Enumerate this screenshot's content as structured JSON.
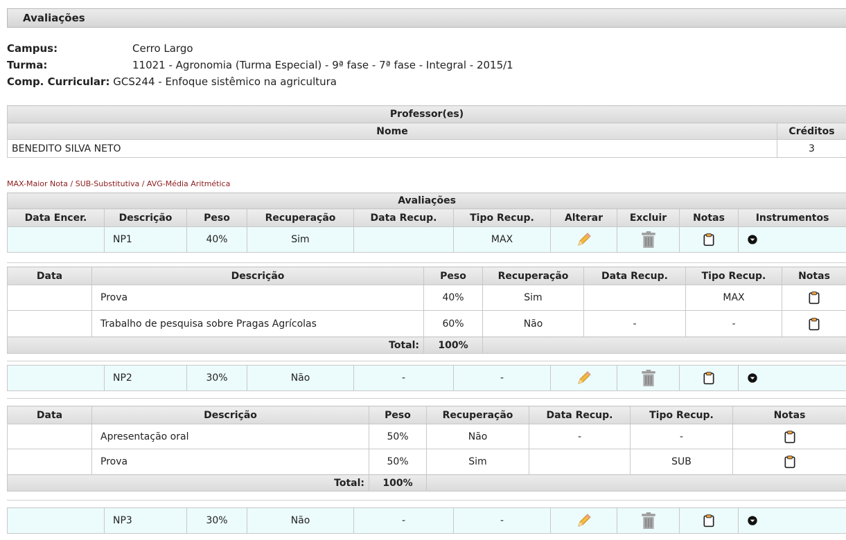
{
  "page_title": "Avaliações",
  "info": {
    "campus_label": "Campus:",
    "campus": "Cerro Largo",
    "turma_label": "Turma:",
    "turma": "11021 - Agronomia (Turma Especial) - 9ª fase - 7ª fase - Integral - 2015/1",
    "comp_label": "Comp. Curricular:",
    "comp": "GCS244 - Enfoque sistêmico na agricultura"
  },
  "professores": {
    "title": "Professor(es)",
    "col_nome": "Nome",
    "col_creditos": "Créditos",
    "rows": [
      {
        "nome": "BENEDITO SILVA NETO",
        "creditos": "3"
      }
    ]
  },
  "legend": "MAX-Maior Nota / SUB-Substitutiva / AVG-Média Aritmética",
  "avaliacoes": {
    "title": "Avaliações",
    "headers": [
      "Data Encer.",
      "Descrição",
      "Peso",
      "Recuperação",
      "Data Recup.",
      "Tipo Recup.",
      "Alterar",
      "Excluir",
      "Notas",
      "Instrumentos"
    ],
    "rows": [
      {
        "data": "",
        "descricao": "NP1",
        "peso": "40%",
        "recuperacao": "Sim",
        "data_recup": "",
        "tipo_recup": "MAX"
      },
      {
        "data": "",
        "descricao": "NP2",
        "peso": "30%",
        "recuperacao": "Não",
        "data_recup": "-",
        "tipo_recup": "-"
      },
      {
        "data": "",
        "descricao": "NP3",
        "peso": "30%",
        "recuperacao": "Não",
        "data_recup": "-",
        "tipo_recup": "-"
      }
    ]
  },
  "sub1": {
    "headers": [
      "Data",
      "Descrição",
      "Peso",
      "Recuperação",
      "Data Recup.",
      "Tipo Recup.",
      "Notas"
    ],
    "rows": [
      {
        "data": "",
        "descricao": "Prova",
        "peso": "40%",
        "recuperacao": "Sim",
        "data_recup": "",
        "tipo_recup": "MAX"
      },
      {
        "data": "",
        "descricao": "Trabalho de pesquisa sobre Pragas Agrícolas",
        "peso": "60%",
        "recuperacao": "Não",
        "data_recup": "-",
        "tipo_recup": "-"
      }
    ],
    "total_label": "Total:",
    "total": "100%"
  },
  "sub2": {
    "headers": [
      "Data",
      "Descrição",
      "Peso",
      "Recuperação",
      "Data Recup.",
      "Tipo Recup.",
      "Notas"
    ],
    "rows": [
      {
        "data": "",
        "descricao": "Apresentação oral",
        "peso": "50%",
        "recuperacao": "Não",
        "data_recup": "-",
        "tipo_recup": "-"
      },
      {
        "data": "",
        "descricao": "Prova",
        "peso": "50%",
        "recuperacao": "Sim",
        "data_recup": "",
        "tipo_recup": "SUB"
      }
    ],
    "total_label": "Total:",
    "total": "100%"
  },
  "icons": {
    "edit": "pencil-icon",
    "delete": "trash-icon",
    "grades": "clipboard-icon",
    "instruments": "expand-circle-icon"
  },
  "colors": {
    "row_highlight": "#ecfbfb",
    "legend_text": "#8b1c1c",
    "header_bg": "#dcdcdc"
  }
}
